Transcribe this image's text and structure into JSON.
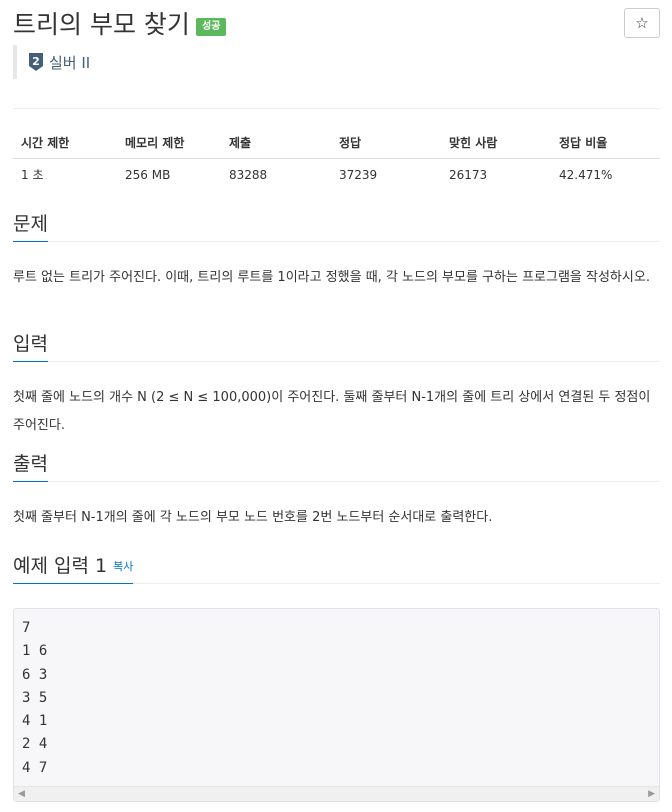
{
  "problem": {
    "title": "트리의 부모 찾기",
    "result_badge": "성공",
    "star_icon": "☆",
    "tier": {
      "number": "2",
      "label": "실버 II",
      "color": "#435f7a"
    }
  },
  "info_table": {
    "headers": [
      "시간 제한",
      "메모리 제한",
      "제출",
      "정답",
      "맞힌 사람",
      "정답 비율"
    ],
    "values": [
      "1 초",
      "256 MB",
      "83288",
      "37239",
      "26173",
      "42.471%"
    ]
  },
  "sections": {
    "description": {
      "heading": "문제",
      "text": "루트 없는 트리가 주어진다. 이때, 트리의 루트를 1이라고 정했을 때, 각 노드의 부모를 구하는 프로그램을 작성하시오."
    },
    "input": {
      "heading": "입력",
      "text": "첫째 줄에 노드의 개수 N (2 ≤ N ≤ 100,000)이 주어진다. 둘째 줄부터 N-1개의 줄에 트리 상에서 연결된 두 정점이 주어진다."
    },
    "output": {
      "heading": "출력",
      "text": "첫째 줄부터 N-1개의 줄에 각 노드의 부모 노드 번호를 2번 노드부터 순서대로 출력한다."
    },
    "sample_input": {
      "heading": "예제 입력 1",
      "copy_label": "복사",
      "lines": [
        "7",
        "1 6",
        "6 3",
        "3 5",
        "4 1",
        "2 4",
        "4 7"
      ]
    }
  },
  "colors": {
    "badge_success": "#5cb85c",
    "link": "#0076c0",
    "tier_silver": "#435f7a"
  }
}
